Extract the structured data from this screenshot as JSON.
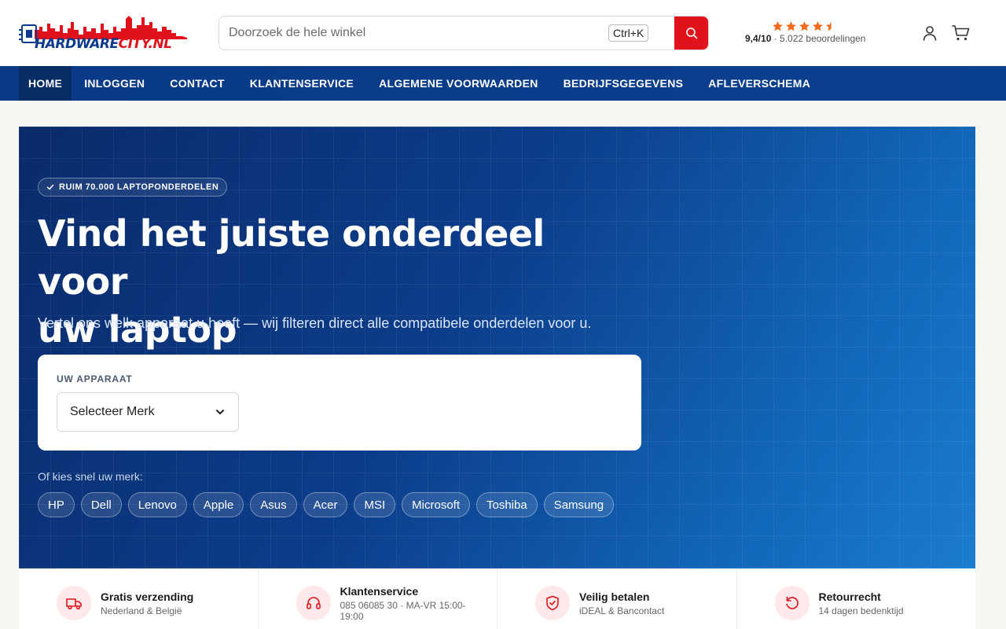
{
  "brand": {
    "name": "HARDWARECITY.NL",
    "name_part1": "HARDWARE",
    "name_part2": "CITY.NL"
  },
  "search": {
    "placeholder": "Doorzoek de hele winkel",
    "shortcut": "Ctrl+K"
  },
  "rating": {
    "score": "9,4/10",
    "reviews": "· 5.022 beoordelingen",
    "stars": 4.5
  },
  "nav": {
    "items": [
      {
        "label": "HOME",
        "active": true
      },
      {
        "label": "INLOGGEN"
      },
      {
        "label": "CONTACT"
      },
      {
        "label": "KLANTENSERVICE"
      },
      {
        "label": "ALGEMENE VOORWAARDEN"
      },
      {
        "label": "BEDRIJFSGEGEVENS"
      },
      {
        "label": "AFLEVERSCHEMA"
      }
    ]
  },
  "hero": {
    "badge": "RUIM 70.000 LAPTOPONDERDELEN",
    "title_line1": "Vind het juiste onderdeel voor",
    "title_line2": "uw laptop",
    "subtitle": "Vertel ons welk apparaat u heeft — wij filteren direct alle compatibele onderdelen voor u.",
    "device_label": "UW APPARAAT",
    "select_value": "Selecteer Merk",
    "quick_label": "Of kies snel uw merk:",
    "brands": [
      "HP",
      "Dell",
      "Lenovo",
      "Apple",
      "Asus",
      "Acer",
      "MSI",
      "Microsoft",
      "Toshiba",
      "Samsung"
    ]
  },
  "usps": [
    {
      "title": "Gratis verzending",
      "sub": "Nederland & België",
      "icon": "truck-icon"
    },
    {
      "title": "Klantenservice",
      "sub": "085 06085 30 · MA-VR 15:00-19:00",
      "icon": "headset-icon"
    },
    {
      "title": "Veilig betalen",
      "sub": "iDEAL & Bancontact",
      "icon": "shield-check-icon"
    },
    {
      "title": "Retourrecht",
      "sub": "14 dagen bedenktijd",
      "icon": "return-icon"
    }
  ],
  "colors": {
    "accent": "#e1121b",
    "nav": "#0b3f8f",
    "star": "#f26b1d"
  }
}
